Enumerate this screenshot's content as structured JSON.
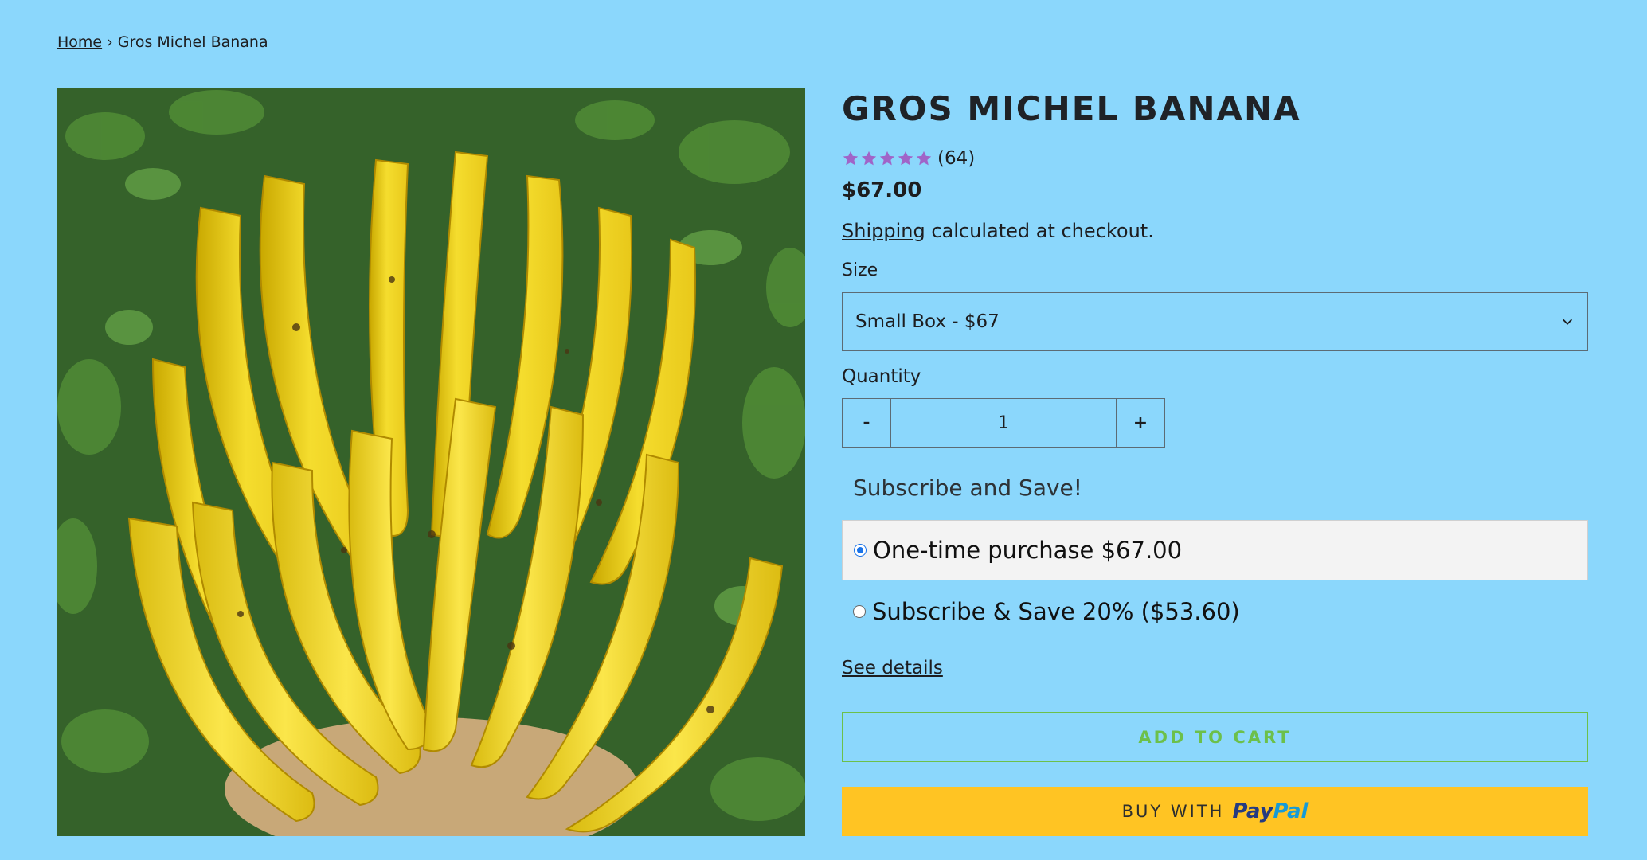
{
  "breadcrumb": {
    "home": "Home",
    "separator": "›",
    "current": "Gros Michel Banana"
  },
  "product": {
    "title": "GROS MICHEL BANANA",
    "rating": 5,
    "rating_max": 5,
    "review_count": "(64)",
    "price": "$67.00",
    "shipping_link": "Shipping",
    "shipping_text": "calculated at checkout."
  },
  "size": {
    "label": "Size",
    "selected": "Small Box - $67"
  },
  "quantity": {
    "label": "Quantity",
    "minus": "-",
    "value": "1",
    "plus": "+"
  },
  "subscription": {
    "title": "Subscribe and Save!",
    "options": [
      {
        "label": "One-time purchase $67.00",
        "selected": true
      },
      {
        "label": "Subscribe & Save 20% ($53.60)",
        "selected": false
      }
    ],
    "details_link": "See details"
  },
  "actions": {
    "add_to_cart": "ADD TO CART",
    "paypal_prefix": "BUY WITH",
    "paypal_brand_a": "Pay",
    "paypal_brand_b": "Pal"
  },
  "colors": {
    "background": "#8bd7fc",
    "star": "#a064c8",
    "add_to_cart": "#6cc04a",
    "paypal_button": "#ffc423"
  },
  "icons": {
    "rating": "star-icon",
    "dropdown": "chevron-down-icon"
  }
}
